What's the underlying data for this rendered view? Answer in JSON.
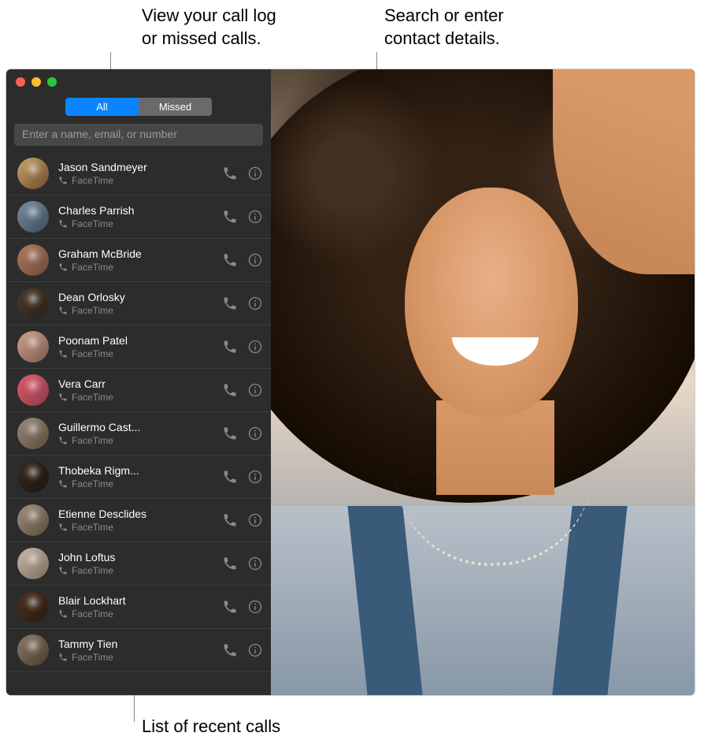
{
  "callouts": {
    "tabs": "View your call log\nor missed calls.",
    "search": "Search or enter\ncontact details.",
    "list": "List of recent calls"
  },
  "tabs": {
    "all": "All",
    "missed": "Missed"
  },
  "search": {
    "placeholder": "Enter a name, email, or number"
  },
  "service_label": "FaceTime",
  "calls": [
    {
      "name": "Jason Sandmeyer"
    },
    {
      "name": "Charles Parrish"
    },
    {
      "name": "Graham McBride"
    },
    {
      "name": "Dean Orlosky"
    },
    {
      "name": "Poonam Patel"
    },
    {
      "name": "Vera Carr"
    },
    {
      "name": "Guillermo Cast..."
    },
    {
      "name": "Thobeka Rigm..."
    },
    {
      "name": "Etienne Desclides"
    },
    {
      "name": "John Loftus"
    },
    {
      "name": "Blair Lockhart"
    },
    {
      "name": "Tammy Tien"
    }
  ]
}
